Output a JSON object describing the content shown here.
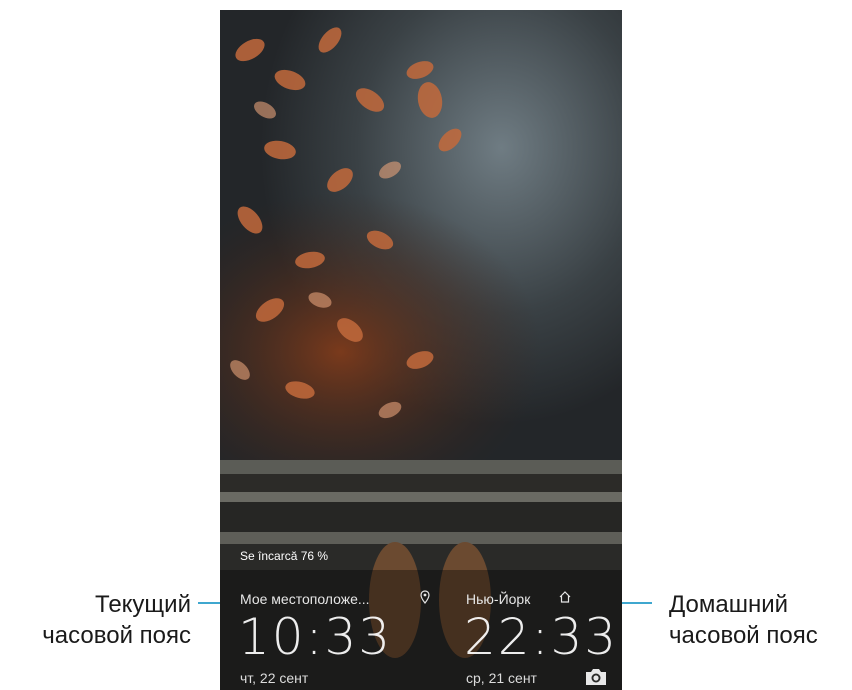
{
  "annotations": {
    "left": {
      "line1": "Текущий",
      "line2": "часовой пояс"
    },
    "right": {
      "line1": "Домашний",
      "line2": "часовой пояс"
    }
  },
  "lockscreen": {
    "charging_text": "Se încarcă 76 %",
    "clock_local": {
      "label": "Мое местоположе...",
      "time": "10:33",
      "date": "чт, 22 сент",
      "icon": "location-pin-icon"
    },
    "clock_home": {
      "label": "Нью-Йорк",
      "time": "22:33",
      "date": "ср, 21 сент",
      "icon": "home-icon"
    },
    "camera_icon": "camera-icon"
  },
  "colors": {
    "leader_line": "#3fa7cf"
  }
}
